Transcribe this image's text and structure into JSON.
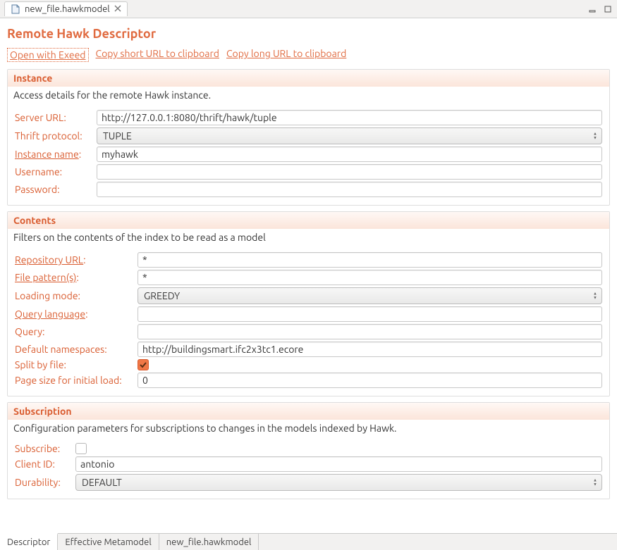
{
  "topTab": {
    "filename": "new_file.hawkmodel"
  },
  "title": "Remote Hawk Descriptor",
  "links": {
    "open_exeed": "Open with Exeed",
    "copy_short": "Copy short URL to clipboard",
    "copy_long": "Copy long URL to clipboard"
  },
  "instance": {
    "heading": "Instance",
    "desc": "Access details for the remote Hawk instance.",
    "labels": {
      "server_url": "Server URL:",
      "thrift": "Thrift protocol:",
      "instance_name_prefix": "Instance name",
      "instance_name_colon": ":",
      "username": "Username:",
      "password": "Password:"
    },
    "values": {
      "server_url": "http://127.0.0.1:8080/thrift/hawk/tuple",
      "thrift": "TUPLE",
      "instance_name": "myhawk",
      "username": "",
      "password": ""
    }
  },
  "contents": {
    "heading": "Contents",
    "desc": "Filters on the contents of the index to be read as a model",
    "labels": {
      "repo_prefix": "Repository URL",
      "repo_colon": ":",
      "file_prefix": "File pattern(s)",
      "file_colon": ":",
      "loading": "Loading mode:",
      "query_lang_prefix": "Query language",
      "query_lang_colon": ":",
      "query": "Query:",
      "defns": "Default namespaces:",
      "split": "Split by file:",
      "page": "Page size for initial load:"
    },
    "values": {
      "repo": "*",
      "file": "*",
      "loading": "GREEDY",
      "query_lang": "",
      "query": "",
      "defns": "http://buildingsmart.ifc2x3tc1.ecore",
      "split": true,
      "page": "0"
    }
  },
  "subscription": {
    "heading": "Subscription",
    "desc": "Configuration parameters for subscriptions to changes in the models indexed by Hawk.",
    "labels": {
      "subscribe": "Subscribe:",
      "client": "Client ID:",
      "durability": "Durability:"
    },
    "values": {
      "subscribe": false,
      "client": "antonio",
      "durability": "DEFAULT"
    }
  },
  "bottomTabs": {
    "descriptor": "Descriptor",
    "metamodel": "Effective Metamodel",
    "filetab": "new_file.hawkmodel"
  }
}
